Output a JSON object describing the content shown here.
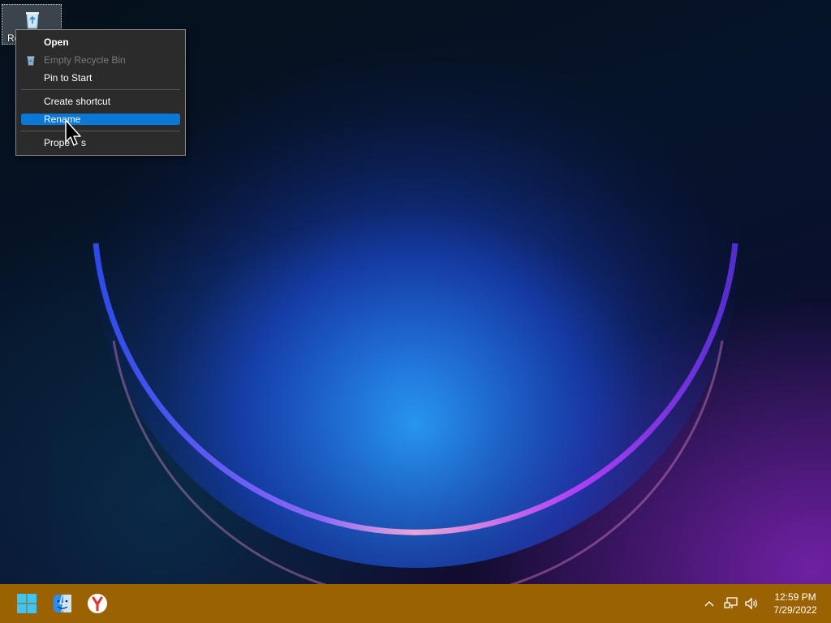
{
  "desktop": {
    "icons": [
      {
        "label": "Re",
        "icon": "recycle-bin-icon"
      }
    ]
  },
  "context_menu": {
    "items": [
      {
        "label": "Open",
        "bold": true
      },
      {
        "label": "Empty Recycle Bin",
        "disabled": true,
        "icon": "recycle-bin-icon"
      },
      {
        "label": "Pin to Start"
      },
      {
        "label": "Create shortcut"
      },
      {
        "label": "Rename",
        "highlighted": true
      },
      {
        "label": "Prope",
        "suffix": "s"
      }
    ]
  },
  "taskbar": {
    "apps": [
      {
        "name": "start",
        "icon": "windows-logo-icon"
      },
      {
        "name": "file-explorer",
        "icon": "finder-face-icon"
      },
      {
        "name": "yandex-browser",
        "icon": "yandex-icon"
      }
    ],
    "tray": {
      "icons": [
        "chevron-up-icon",
        "network-icon",
        "volume-icon"
      ],
      "time": "12:59 PM",
      "date": "7/29/2022"
    }
  },
  "colors": {
    "taskbar_bg": "#9a6200",
    "menu_bg": "#2b2b2b",
    "menu_highlight": "#0a78d7"
  }
}
